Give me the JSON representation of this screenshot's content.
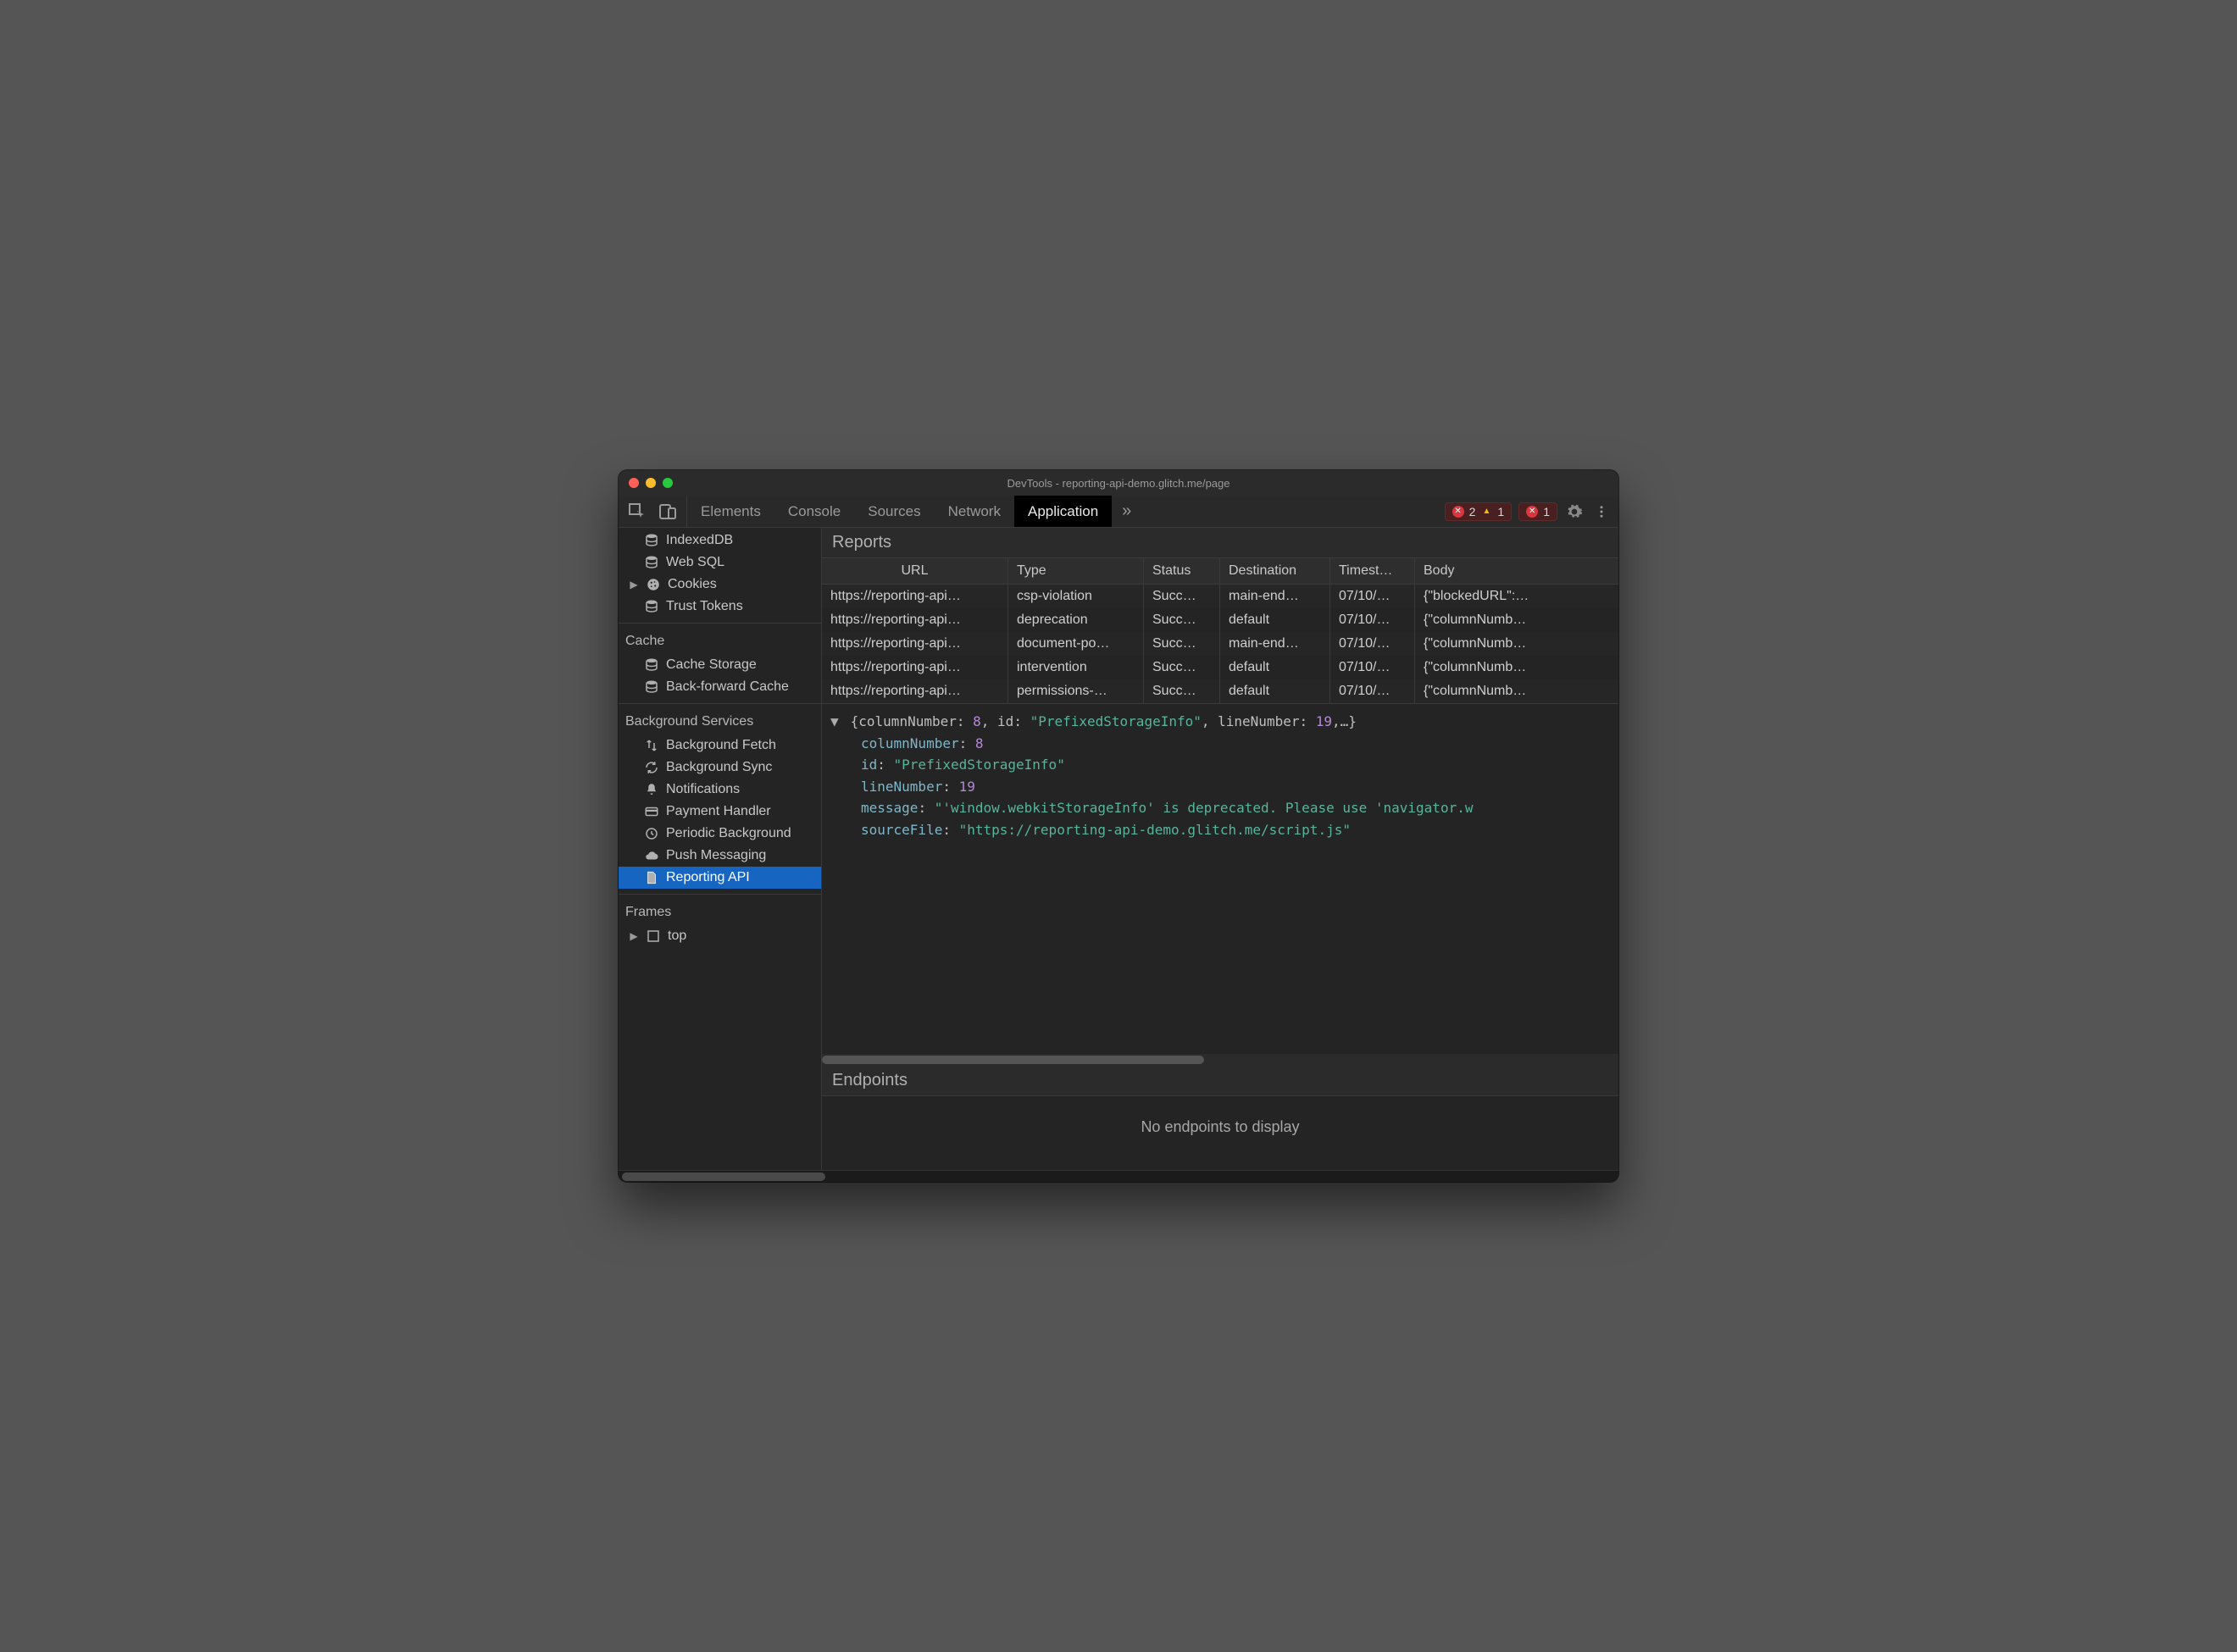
{
  "window": {
    "title": "DevTools - reporting-api-demo.glitch.me/page"
  },
  "tabs": {
    "items": [
      "Elements",
      "Console",
      "Sources",
      "Network",
      "Application"
    ],
    "active": "Application"
  },
  "status": {
    "errors": "2",
    "warnings": "1",
    "messages": "1"
  },
  "sidebar": {
    "storage_items": [
      {
        "label": "IndexedDB",
        "icon": "db"
      },
      {
        "label": "Web SQL",
        "icon": "db"
      },
      {
        "label": "Cookies",
        "icon": "cookie",
        "caret": true
      },
      {
        "label": "Trust Tokens",
        "icon": "db"
      }
    ],
    "cache_title": "Cache",
    "cache_items": [
      {
        "label": "Cache Storage",
        "icon": "db"
      },
      {
        "label": "Back-forward Cache",
        "icon": "db"
      }
    ],
    "bg_title": "Background Services",
    "bg_items": [
      {
        "label": "Background Fetch",
        "icon": "updown"
      },
      {
        "label": "Background Sync",
        "icon": "sync"
      },
      {
        "label": "Notifications",
        "icon": "bell"
      },
      {
        "label": "Payment Handler",
        "icon": "card"
      },
      {
        "label": "Periodic Background",
        "icon": "clock"
      },
      {
        "label": "Push Messaging",
        "icon": "cloud"
      },
      {
        "label": "Reporting API",
        "icon": "doc",
        "selected": true
      }
    ],
    "frames_title": "Frames",
    "frames_items": [
      {
        "label": "top",
        "icon": "frame",
        "caret": true
      }
    ]
  },
  "reports": {
    "title": "Reports",
    "columns": [
      "URL",
      "Type",
      "Status",
      "Destination",
      "Timest…",
      "Body"
    ],
    "rows": [
      {
        "url": "https://reporting-api…",
        "type": "csp-violation",
        "status": "Succ…",
        "destination": "main-end…",
        "timestamp": "07/10/…",
        "body": "{\"blockedURL\":…"
      },
      {
        "url": "https://reporting-api…",
        "type": "deprecation",
        "status": "Succ…",
        "destination": "default",
        "timestamp": "07/10/…",
        "body": "{\"columnNumb…"
      },
      {
        "url": "https://reporting-api…",
        "type": "document-po…",
        "status": "Succ…",
        "destination": "main-end…",
        "timestamp": "07/10/…",
        "body": "{\"columnNumb…"
      },
      {
        "url": "https://reporting-api…",
        "type": "intervention",
        "status": "Succ…",
        "destination": "default",
        "timestamp": "07/10/…",
        "body": "{\"columnNumb…"
      },
      {
        "url": "https://reporting-api…",
        "type": "permissions-…",
        "status": "Succ…",
        "destination": "default",
        "timestamp": "07/10/…",
        "body": "{\"columnNumb…"
      }
    ]
  },
  "detail": {
    "summary_prefix": "{columnNumber: ",
    "summary_col": "8",
    "summary_mid1": ", id: ",
    "summary_id": "\"PrefixedStorageInfo\"",
    "summary_mid2": ", lineNumber: ",
    "summary_line": "19",
    "summary_suffix": ",…}",
    "columnNumber_label": "columnNumber",
    "columnNumber_value": "8",
    "id_label": "id",
    "id_value": "\"PrefixedStorageInfo\"",
    "lineNumber_label": "lineNumber",
    "lineNumber_value": "19",
    "message_label": "message",
    "message_value": "\"'window.webkitStorageInfo' is deprecated. Please use 'navigator.w",
    "sourceFile_label": "sourceFile",
    "sourceFile_value": "\"https://reporting-api-demo.glitch.me/script.js\""
  },
  "endpoints": {
    "title": "Endpoints",
    "empty": "No endpoints to display"
  }
}
